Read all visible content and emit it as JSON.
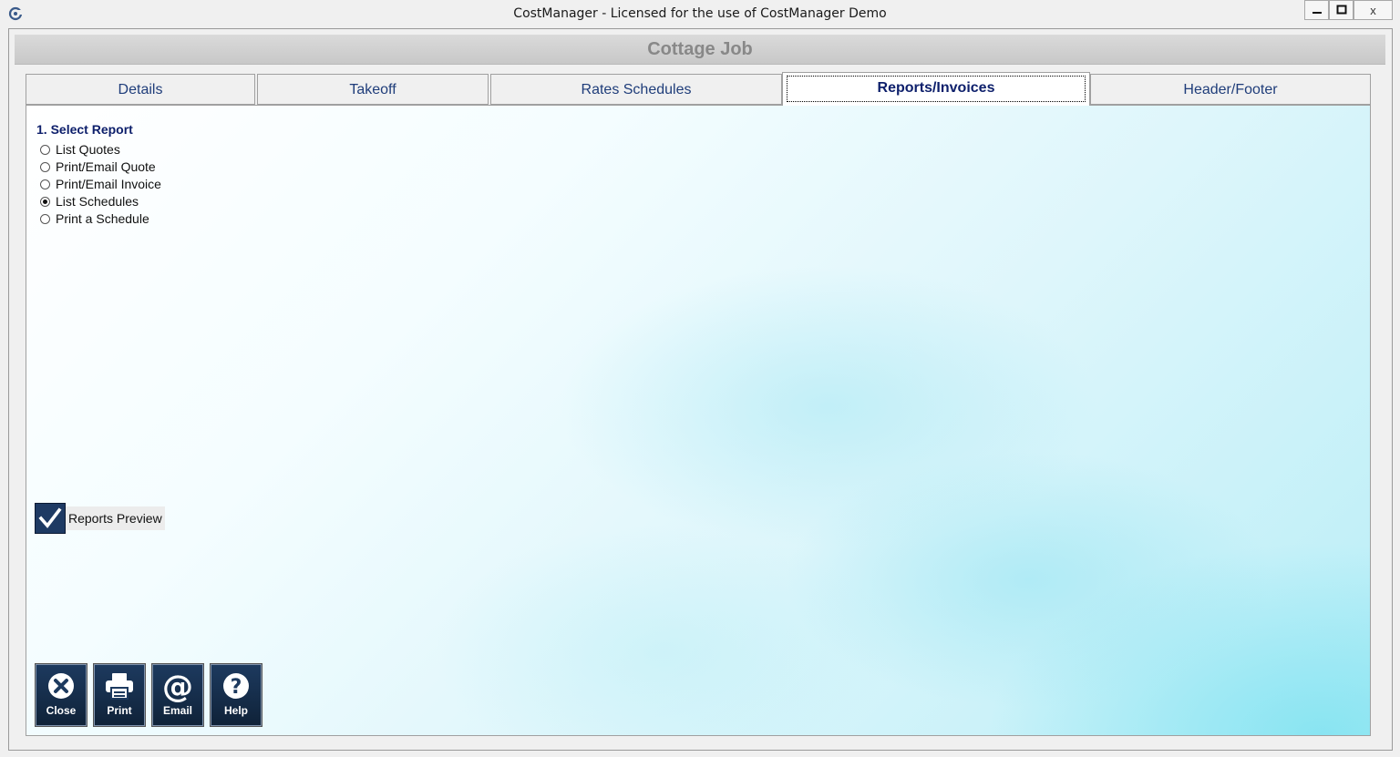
{
  "window": {
    "title": "CostManager - Licensed for the use of CostManager Demo",
    "icon": "app-logo-icon",
    "controls": {
      "minimize": "minimize-icon",
      "maximize": "maximize-icon",
      "close": "x"
    }
  },
  "job": {
    "title": "Cottage Job"
  },
  "tabs": [
    {
      "label": "Details",
      "active": false
    },
    {
      "label": "Takeoff",
      "active": false
    },
    {
      "label": "Rates Schedules",
      "active": false
    },
    {
      "label": "Reports/Invoices",
      "active": true
    },
    {
      "label": "Header/Footer",
      "active": false
    }
  ],
  "reports": {
    "section_title": "1. Select Report",
    "options": [
      {
        "label": "List Quotes",
        "selected": false
      },
      {
        "label": "Print/Email Quote",
        "selected": false
      },
      {
        "label": "Print/Email Invoice",
        "selected": false
      },
      {
        "label": "List Schedules",
        "selected": true
      },
      {
        "label": "Print a Schedule",
        "selected": false
      }
    ],
    "preview": {
      "label": "Reports Preview",
      "checked": true
    }
  },
  "toolbar": {
    "close_label": "Close",
    "print_label": "Print",
    "email_label": "Email",
    "help_label": "Help"
  },
  "colors": {
    "accent": "#0d1f6b",
    "button_bg": "#1d3a5f",
    "panel_tint": "#b9eef7"
  }
}
